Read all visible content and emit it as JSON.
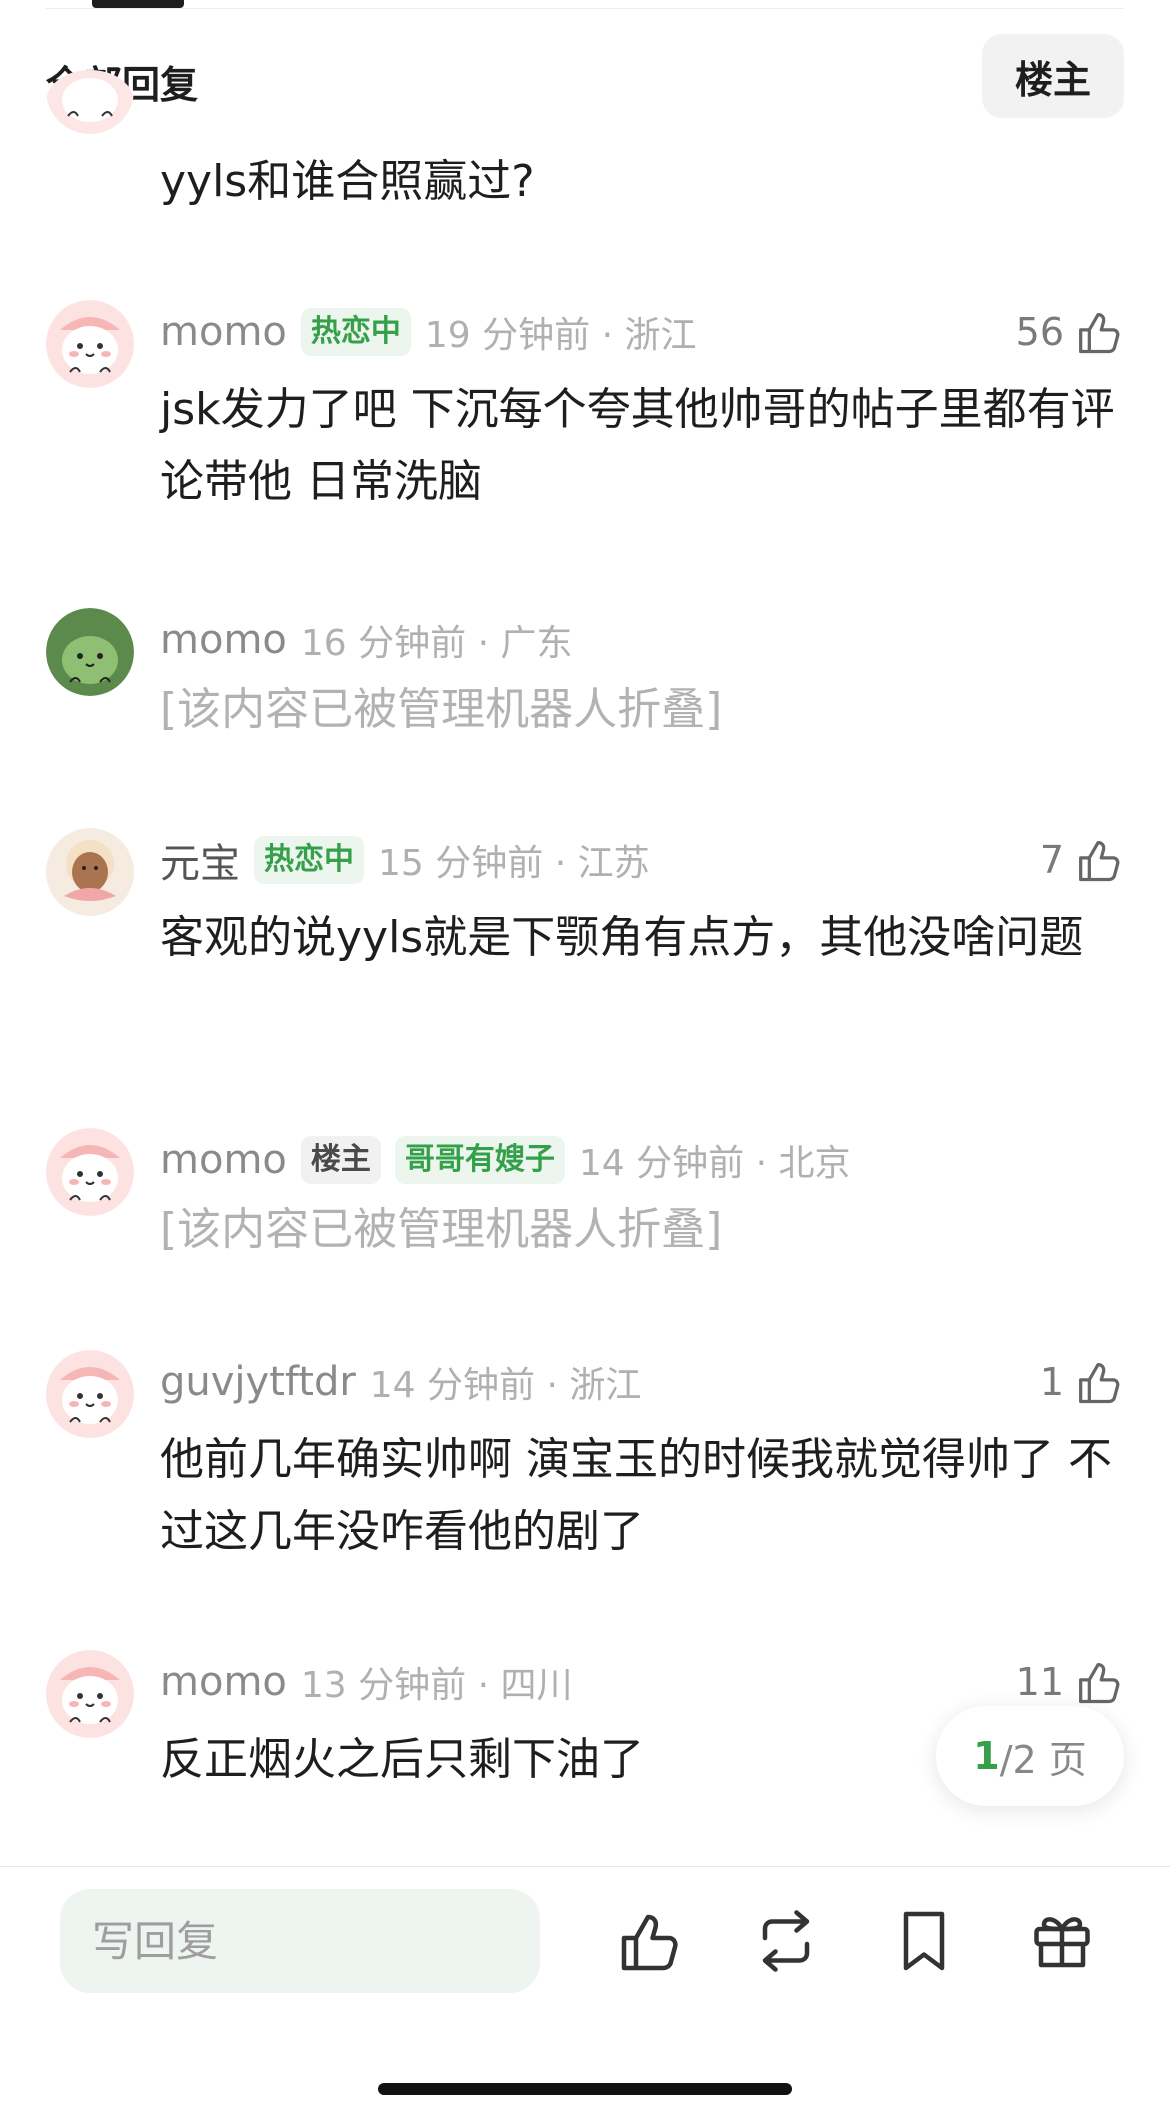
{
  "header": {
    "title": "全部回复",
    "op_only": "楼主"
  },
  "comments": [
    {
      "content": "yyls和谁合照赢过?",
      "avatar": "pink-blob"
    },
    {
      "user": "momo",
      "badges": [
        "热恋中"
      ],
      "time": "19 分钟前 · 浙江",
      "likes": "56",
      "content": "jsk发力了吧 下沉每个夸其他帅哥的帖子里都有评论带他 日常洗脑",
      "avatar": "pink-blob"
    },
    {
      "user": "momo",
      "time": "16 分钟前 · 广东",
      "content": "[该内容已被管理机器人折叠]",
      "avatar": "green-blob"
    },
    {
      "user": "元宝",
      "badges": [
        "热恋中"
      ],
      "time": "15 分钟前 · 江苏",
      "likes": "7",
      "content": "客观的说yyls就是下颚角有点方，其他没啥问题",
      "avatar": "buddha"
    },
    {
      "user": "momo",
      "badges": [
        "楼主",
        "哥哥有嫂子"
      ],
      "time": "14 分钟前 · 北京",
      "content": "[该内容已被管理机器人折叠]",
      "avatar": "pink-blob"
    },
    {
      "user": "guvjytftdr",
      "time": "14 分钟前 · 浙江",
      "likes": "1",
      "content": "他前几年确实帅啊 演宝玉的时候我就觉得帅了 不过这几年没咋看他的剧了",
      "avatar": "pink-blob"
    },
    {
      "user": "momo",
      "time": "13 分钟前 · 四川",
      "likes": "11",
      "content": "反正烟火之后只剩下油了",
      "avatar": "pink-blob"
    }
  ],
  "pager": {
    "current": "1",
    "total": "/2 页"
  },
  "bottom_bar": {
    "reply_placeholder": "写回复"
  },
  "colors": {
    "accent_green": "#35a04a",
    "badge_green_bg": "#edf6ee",
    "folded_text": "#b2b2b2"
  }
}
